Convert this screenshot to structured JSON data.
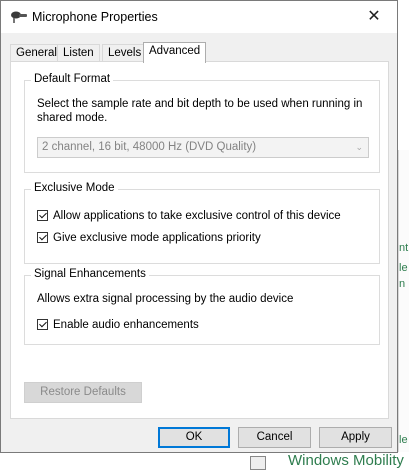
{
  "window": {
    "title": "Microphone Properties",
    "close_glyph": "✕"
  },
  "tabs": [
    {
      "label": "General",
      "active": false
    },
    {
      "label": "Listen",
      "active": false
    },
    {
      "label": "Levels",
      "active": false
    },
    {
      "label": "Advanced",
      "active": true
    }
  ],
  "default_format": {
    "title": "Default Format",
    "description": "Select the sample rate and bit depth to be used when running in shared mode.",
    "selected_format": "2 channel, 16 bit, 48000 Hz (DVD Quality)"
  },
  "exclusive_mode": {
    "title": "Exclusive Mode",
    "options": [
      {
        "label": "Allow applications to take exclusive control of this device",
        "checked": true
      },
      {
        "label": "Give exclusive mode applications priority",
        "checked": true
      }
    ]
  },
  "signal_enhancements": {
    "title": "Signal Enhancements",
    "description": "Allows extra signal processing by the audio device",
    "option": {
      "label": "Enable audio enhancements",
      "checked": true
    }
  },
  "buttons": {
    "restore": "Restore Defaults",
    "ok": "OK",
    "cancel": "Cancel",
    "apply": "Apply"
  },
  "background": {
    "bottom_text": "Windows Mobility"
  }
}
